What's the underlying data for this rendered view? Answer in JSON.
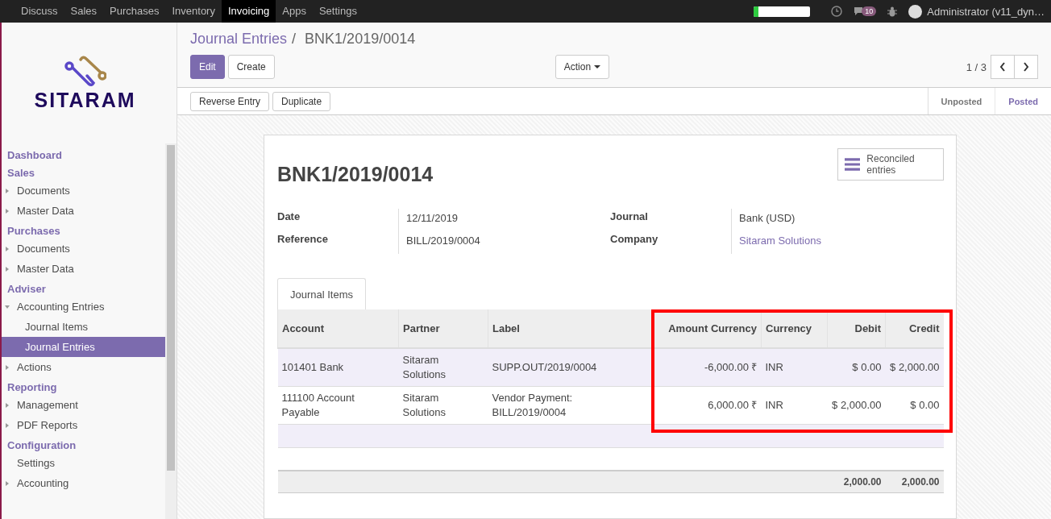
{
  "top_menu": [
    {
      "label": "Discuss",
      "selected": false
    },
    {
      "label": "Sales",
      "selected": false
    },
    {
      "label": "Purchases",
      "selected": false
    },
    {
      "label": "Inventory",
      "selected": false
    },
    {
      "label": "Invoicing",
      "selected": true
    },
    {
      "label": "Apps",
      "selected": false
    },
    {
      "label": "Settings",
      "selected": false
    }
  ],
  "systray": {
    "progress": {
      "level": 0.08
    },
    "message_count": "10",
    "user": "Administrator (v11_dyn…"
  },
  "logo": {
    "text": "SITARAM"
  },
  "sidebar": [
    {
      "title": "Dashboard"
    },
    {
      "title": "Sales",
      "items": [
        {
          "label": "Documents",
          "kind": "folder",
          "expanded": false,
          "selected": false
        },
        {
          "label": "Master Data",
          "kind": "folder",
          "expanded": false,
          "selected": false
        }
      ]
    },
    {
      "title": "Purchases",
      "items": [
        {
          "label": "Documents",
          "kind": "folder",
          "expanded": false,
          "selected": false
        },
        {
          "label": "Master Data",
          "kind": "folder",
          "expanded": false,
          "selected": false
        }
      ]
    },
    {
      "title": "Adviser",
      "items": [
        {
          "label": "Accounting Entries",
          "kind": "folder",
          "expanded": true,
          "selected": false,
          "children": [
            {
              "label": "Journal Items",
              "selected": false
            },
            {
              "label": "Journal Entries",
              "selected": true
            }
          ]
        },
        {
          "label": "Actions",
          "kind": "folder",
          "expanded": false,
          "selected": false
        }
      ]
    },
    {
      "title": "Reporting",
      "items": [
        {
          "label": "Management",
          "kind": "folder",
          "expanded": false,
          "selected": false
        },
        {
          "label": "PDF Reports",
          "kind": "folder",
          "expanded": false,
          "selected": false
        }
      ]
    },
    {
      "title": "Configuration",
      "items": [
        {
          "label": "Settings",
          "kind": "link",
          "selected": false
        },
        {
          "label": "Accounting",
          "kind": "folder",
          "expanded": false,
          "selected": false
        }
      ]
    }
  ],
  "breadcrumb": {
    "parent": "Journal Entries",
    "separator": "/",
    "current": "BNK1/2019/0014"
  },
  "buttons": {
    "edit": "Edit",
    "create": "Create",
    "action": "Action"
  },
  "pager": "1 / 3",
  "header_buttons": [
    "Reverse Entry",
    "Duplicate"
  ],
  "stages": [
    {
      "label": "Unposted",
      "selected": false
    },
    {
      "label": "Posted",
      "selected": true
    }
  ],
  "form": {
    "title": "BNK1/2019/0014",
    "smart_button": "Reconciled entries",
    "left_fields": [
      {
        "label": "Date",
        "value": "12/11/2019",
        "kind": "text"
      },
      {
        "label": "Reference",
        "value": "BILL/2019/0004",
        "kind": "text"
      }
    ],
    "right_fields": [
      {
        "label": "Journal",
        "value": "Bank (USD)",
        "kind": "text"
      },
      {
        "label": "Company",
        "value": "Sitaram Solutions",
        "kind": "link"
      }
    ],
    "tabs": [
      {
        "label": "Journal Items",
        "selected": true
      }
    ],
    "table": {
      "columns": [
        "Account",
        "Partner",
        "Label",
        "Amount Currency",
        "Currency",
        "Debit",
        "Credit"
      ],
      "rows": [
        [
          "101401 Bank",
          "Sitaram Solutions",
          "SUPP.OUT/2019/0004",
          "-6,000.00 ₹",
          "INR",
          "$ 0.00",
          "$ 2,000.00"
        ],
        [
          "111100 Account Payable",
          "Sitaram Solutions",
          "Vendor Payment: BILL/2019/0004",
          "6,000.00 ₹",
          "INR",
          "$ 2,000.00",
          "$ 0.00"
        ]
      ],
      "totals": {
        "debit": "2,000.00",
        "credit": "2,000.00"
      }
    }
  }
}
